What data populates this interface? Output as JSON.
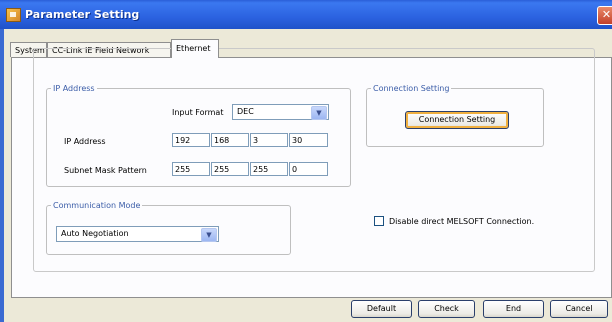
{
  "window": {
    "title": "Parameter Setting",
    "close_glyph": "✕",
    "app_icon": "app-icon"
  },
  "tabs": [
    {
      "label": "System",
      "active": false
    },
    {
      "label": "CC-Link IE Field Network",
      "active": false
    },
    {
      "label": "Ethernet",
      "active": true
    }
  ],
  "ip_address_group": {
    "legend": "IP Address",
    "input_format_label": "Input Format",
    "input_format_value": "DEC",
    "ip_label": "IP Address",
    "ip_octets": [
      "192",
      "168",
      "3",
      "30"
    ],
    "subnet_label": "Subnet Mask Pattern",
    "subnet_octets": [
      "255",
      "255",
      "255",
      "0"
    ]
  },
  "connection_group": {
    "legend": "Connection Setting",
    "button_label": "Connection Setting"
  },
  "communication_group": {
    "legend": "Communication Mode",
    "value": "Auto Negotiation"
  },
  "melsoft_checkbox": {
    "label": "Disable direct MELSOFT Connection.",
    "checked": false
  },
  "footer_buttons": {
    "default": "Default",
    "check": "Check",
    "end": "End",
    "cancel": "Cancel"
  },
  "colors": {
    "titlebar": "#2b62e0",
    "dialog_bg": "#ece9d8",
    "panel_bg": "#fcfcfe",
    "legend_text": "#3b5da8"
  }
}
